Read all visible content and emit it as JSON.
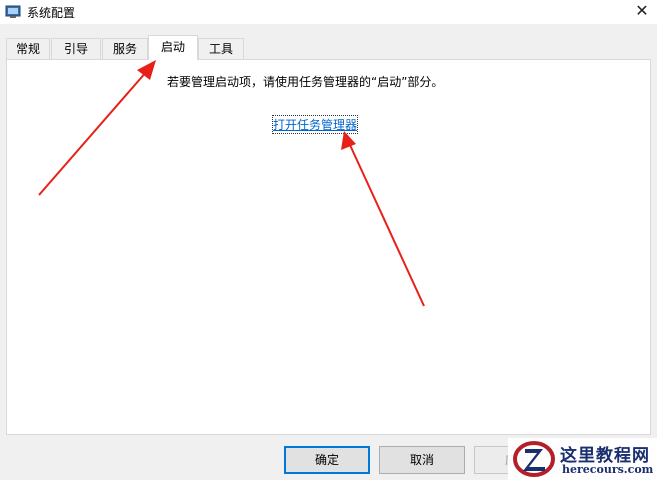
{
  "window": {
    "title": "系统配置",
    "app_icon": "msconfig-icon",
    "close_glyph": "✕"
  },
  "tabs": [
    {
      "label": "常规",
      "active": false
    },
    {
      "label": "引导",
      "active": false
    },
    {
      "label": "服务",
      "active": false
    },
    {
      "label": "启动",
      "active": true
    },
    {
      "label": "工具",
      "active": false
    }
  ],
  "startup_panel": {
    "message": "若要管理启动项，请使用任务管理器的“启动”部分。",
    "link_label": "打开任务管理器"
  },
  "buttons": {
    "ok_label": "确定",
    "cancel_label": "取消",
    "apply_label": "应用"
  },
  "annotations": {
    "arrow_color": "#e8201a"
  },
  "watermark": {
    "name": "这里教程网",
    "url": "herecours.com"
  }
}
